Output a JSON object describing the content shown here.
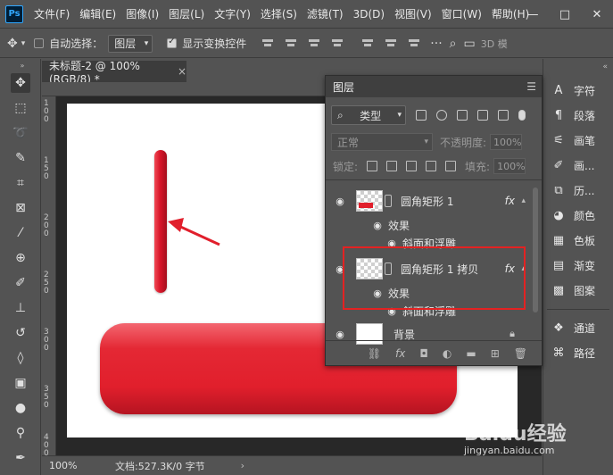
{
  "app": {
    "logo": "Ps",
    "menu": [
      "文件(F)",
      "编辑(E)",
      "图像(I)",
      "图层(L)",
      "文字(Y)",
      "选择(S)",
      "滤镜(T)",
      "3D(D)",
      "视图(V)",
      "窗口(W)",
      "帮助(H)"
    ],
    "window_controls": [
      "—",
      "□",
      "✕"
    ]
  },
  "options_bar": {
    "move_icon": "move-icon",
    "auto_select_label": "自动选择：",
    "auto_select_value": "图层",
    "show_transform_label": "显示变换控件",
    "mode_3d": "3D 模"
  },
  "document": {
    "tab_title": "未标题-2 @ 100%(RGB/8) *",
    "close": "×",
    "zoom": "100%",
    "info": "文档:527.3K/0 字节",
    "ruler_v": [
      "1",
      "0",
      "0",
      "1",
      "5",
      "0",
      "2",
      "0",
      "0",
      "2",
      "5",
      "0",
      "3",
      "0",
      "0",
      "3",
      "5",
      "0",
      "4",
      "0",
      "0"
    ]
  },
  "layers_panel": {
    "tab": "图层",
    "filter_kind": "类型",
    "blend_mode": "正常",
    "opacity_label": "不透明度:",
    "opacity_value": "100%",
    "lock_label": "锁定:",
    "fill_label": "填充:",
    "fill_value": "100%",
    "layers": [
      {
        "name": "圆角矩形 1",
        "effects_label": "效果",
        "effect": "斜面和浮雕",
        "fx": "fx"
      },
      {
        "name": "圆角矩形 1 拷贝",
        "effects_label": "效果",
        "effect": "斜面和浮雕",
        "fx": "fx"
      },
      {
        "name": "背景"
      }
    ],
    "footer_fx": "fx"
  },
  "right_dock": [
    {
      "icon": "type-icon",
      "label": "字符"
    },
    {
      "icon": "paragraph-icon",
      "label": "段落"
    },
    {
      "icon": "brush-settings-icon",
      "label": "画笔"
    },
    {
      "icon": "brush-icon",
      "label": "画..."
    },
    {
      "icon": "history-icon",
      "label": "历..."
    },
    {
      "icon": "color-icon",
      "label": "颜色"
    },
    {
      "icon": "swatches-icon",
      "label": "色板"
    },
    {
      "icon": "gradient-icon",
      "label": "渐变"
    },
    {
      "icon": "pattern-icon",
      "label": "图案"
    },
    {
      "icon": "channels-icon",
      "label": "通道"
    },
    {
      "icon": "paths-icon",
      "label": "路径"
    }
  ],
  "watermark": {
    "brand": "Baidu经验",
    "url": "jingyan.baidu.com"
  },
  "colors": {
    "shape_red": "#e11f2c",
    "highlight_box": "#e32222",
    "ui_bg": "#535353",
    "workspace": "#282828"
  }
}
